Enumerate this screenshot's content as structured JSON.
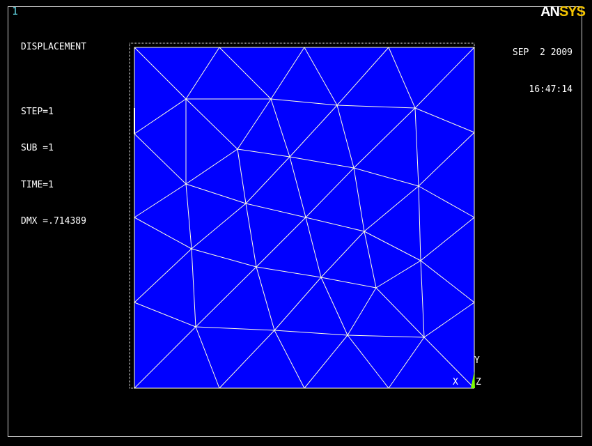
{
  "window": {
    "number": "1"
  },
  "header": {
    "plot_title": "DISPLACEMENT",
    "step": "STEP=1",
    "sub": "SUB =1",
    "time": "TIME=1",
    "dmx": "DMX =.714389"
  },
  "datetime": {
    "date": "SEP  2 2009",
    "time": "16:47:14"
  },
  "logo": {
    "part1": "AN",
    "part2": "SYS"
  },
  "triad": {
    "x": "X",
    "y": "Y",
    "z": "Z"
  },
  "colors": {
    "background": "#000000",
    "mesh_fill": "#0000ff",
    "mesh_edges": "#ffffe0",
    "undeformed_outline": "#ffffff",
    "window_number": "#5fd3e0",
    "logo_accent": "#f4c400",
    "triad": "#7cfc00"
  }
}
